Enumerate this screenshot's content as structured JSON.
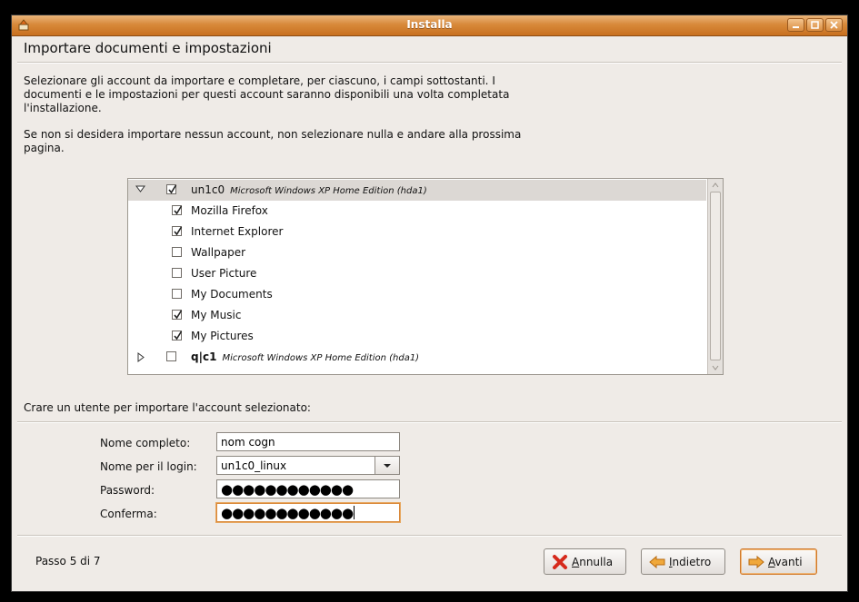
{
  "window": {
    "title": "Installa"
  },
  "header": {
    "title": "Importare documenti e impostazioni"
  },
  "intro": {
    "line1": "Selezionare gli account da importare e completare, per ciascuno, i campi sottostanti. I",
    "line2": "documenti e le impostazioni per questi account saranno disponibili una volta completata",
    "line3": "l'installazione.",
    "line4": "Se non si desidera importare nessun account, non selezionare nulla e andare alla prossima",
    "line5": "pagina."
  },
  "accounts": [
    {
      "name": "un1c0",
      "description": "Microsoft Windows XP Home Edition (hda1)",
      "checked": true,
      "expanded": true,
      "items": [
        {
          "label": "Mozilla Firefox",
          "checked": true
        },
        {
          "label": "Internet Explorer",
          "checked": true
        },
        {
          "label": "Wallpaper",
          "checked": false
        },
        {
          "label": "User Picture",
          "checked": false
        },
        {
          "label": "My Documents",
          "checked": false
        },
        {
          "label": "My Music",
          "checked": true
        },
        {
          "label": "My Pictures",
          "checked": true
        }
      ]
    },
    {
      "name": "q|c1",
      "description": "Microsoft Windows XP Home Edition (hda1)",
      "checked": false,
      "expanded": false
    }
  ],
  "user_form": {
    "section_label": "Crare un utente per importare l'account selezionato:",
    "full_name_label": "Nome completo:",
    "full_name_value": "nom cogn",
    "login_label": "Nome per il login:",
    "login_value": "un1c0_linux",
    "password_label": "Password:",
    "password_value": "●●●●●●●●●●●●",
    "confirm_label": "Conferma:",
    "confirm_value": "●●●●●●●●●●●●"
  },
  "footer": {
    "step": "Passo 5 di 7",
    "cancel_label": "nnulla",
    "cancel_mnemonic": "A",
    "back_label": "ndietro",
    "back_mnemonic": "I",
    "next_label": "vanti",
    "next_mnemonic": "A"
  },
  "colors": {
    "titlebar": "#d8893a",
    "accent": "#d9893a",
    "selected_row": "#dcd8d4"
  }
}
